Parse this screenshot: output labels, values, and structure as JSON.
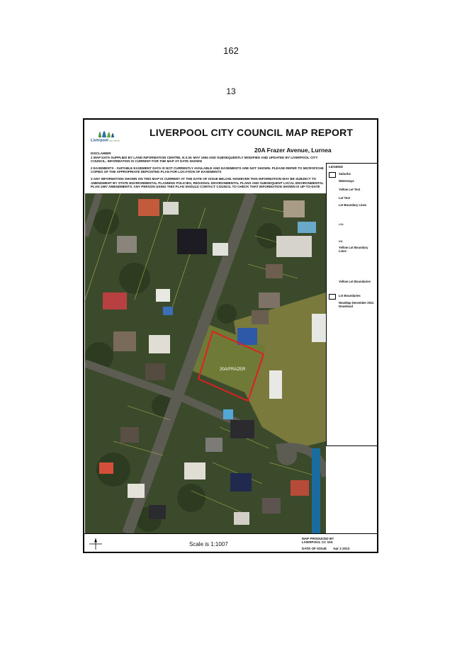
{
  "page": {
    "page_number": "162",
    "sub_number": "13"
  },
  "report": {
    "logo_text": "Liverpool city council",
    "title": "LIVERPOOL CITY COUNCIL MAP REPORT",
    "address": "20A Frazer Avenue, Lurnea",
    "disclaimer": {
      "heading": "DISCLAIMER",
      "item1": "1 MAP DATA SUPPLIED BY LAND INFORMATION CENTRE, N.S.W. MAY 1994 AND SUBSEQUENTLY MODIFIED AND UPDATED BY LIVERPOOL CITY COUNCIL. INFORMATION IS CURRENT FOR THE MAP AT DATE SHOWN",
      "item2": "2 EASEMENTS - SUITABLE EASEMENT DATA IS NOT CURRENTLY AVAILABLE AND EASEMENTS ARE NOT SHOWN. PLEASE REFER TO MICROFICHE COPIES OF THE APPROPRIATE DEPOSITED PLAN FOR LOCATION OF EASEMENTS",
      "item3": "3 ANY INFORMATION SHOWN ON THIS MAP IS CURRENT AT THE DATE OF ISSUE BELOW. HOWEVER THIS INFORMATION MAY BE SUBJECT TO AMENDMENT BY STATE ENVIRONMENTAL PLANNING POLICIES, REGIONAL ENVIRONMENTAL PLANS AND SUBSEQUENT LOCAL ENVIRONMENTAL PLAN 1997 AMENDMENTS. ANY PERSON USING THIS PLAN SHOULD CONTACT COUNCIL TO CHECK THAT INFORMATION SHOWN IS UP-TO-DATE"
    },
    "legend": {
      "title": "LEGEND",
      "items": [
        {
          "label": "Suburbs"
        },
        {
          "label": "Waterways"
        },
        {
          "label": "Yellow Lot Text"
        },
        {
          "label": "Lot Text"
        },
        {
          "label": "Lot Boundary Lines"
        },
        {
          "label": "Yellow Lot Boundary Lines"
        },
        {
          "label": "Yellow Lot Boundaries"
        },
        {
          "label": "Lot Boundaries"
        },
        {
          "label": "NearMap December 2011 Download"
        }
      ],
      "sublabels": [
        "LGA",
        "USL"
      ]
    },
    "map": {
      "lot_label": "20A/FRAZER",
      "highlight_color": "#e02020"
    },
    "footer": {
      "scale": "Scale is 1:1007",
      "produced_by": "MAP PRODUCED BY",
      "producer": "LIVERPOOL CC GIS",
      "issue_label": "DATE OF ISSUE",
      "issue_date": "Apr 2 2013"
    }
  }
}
